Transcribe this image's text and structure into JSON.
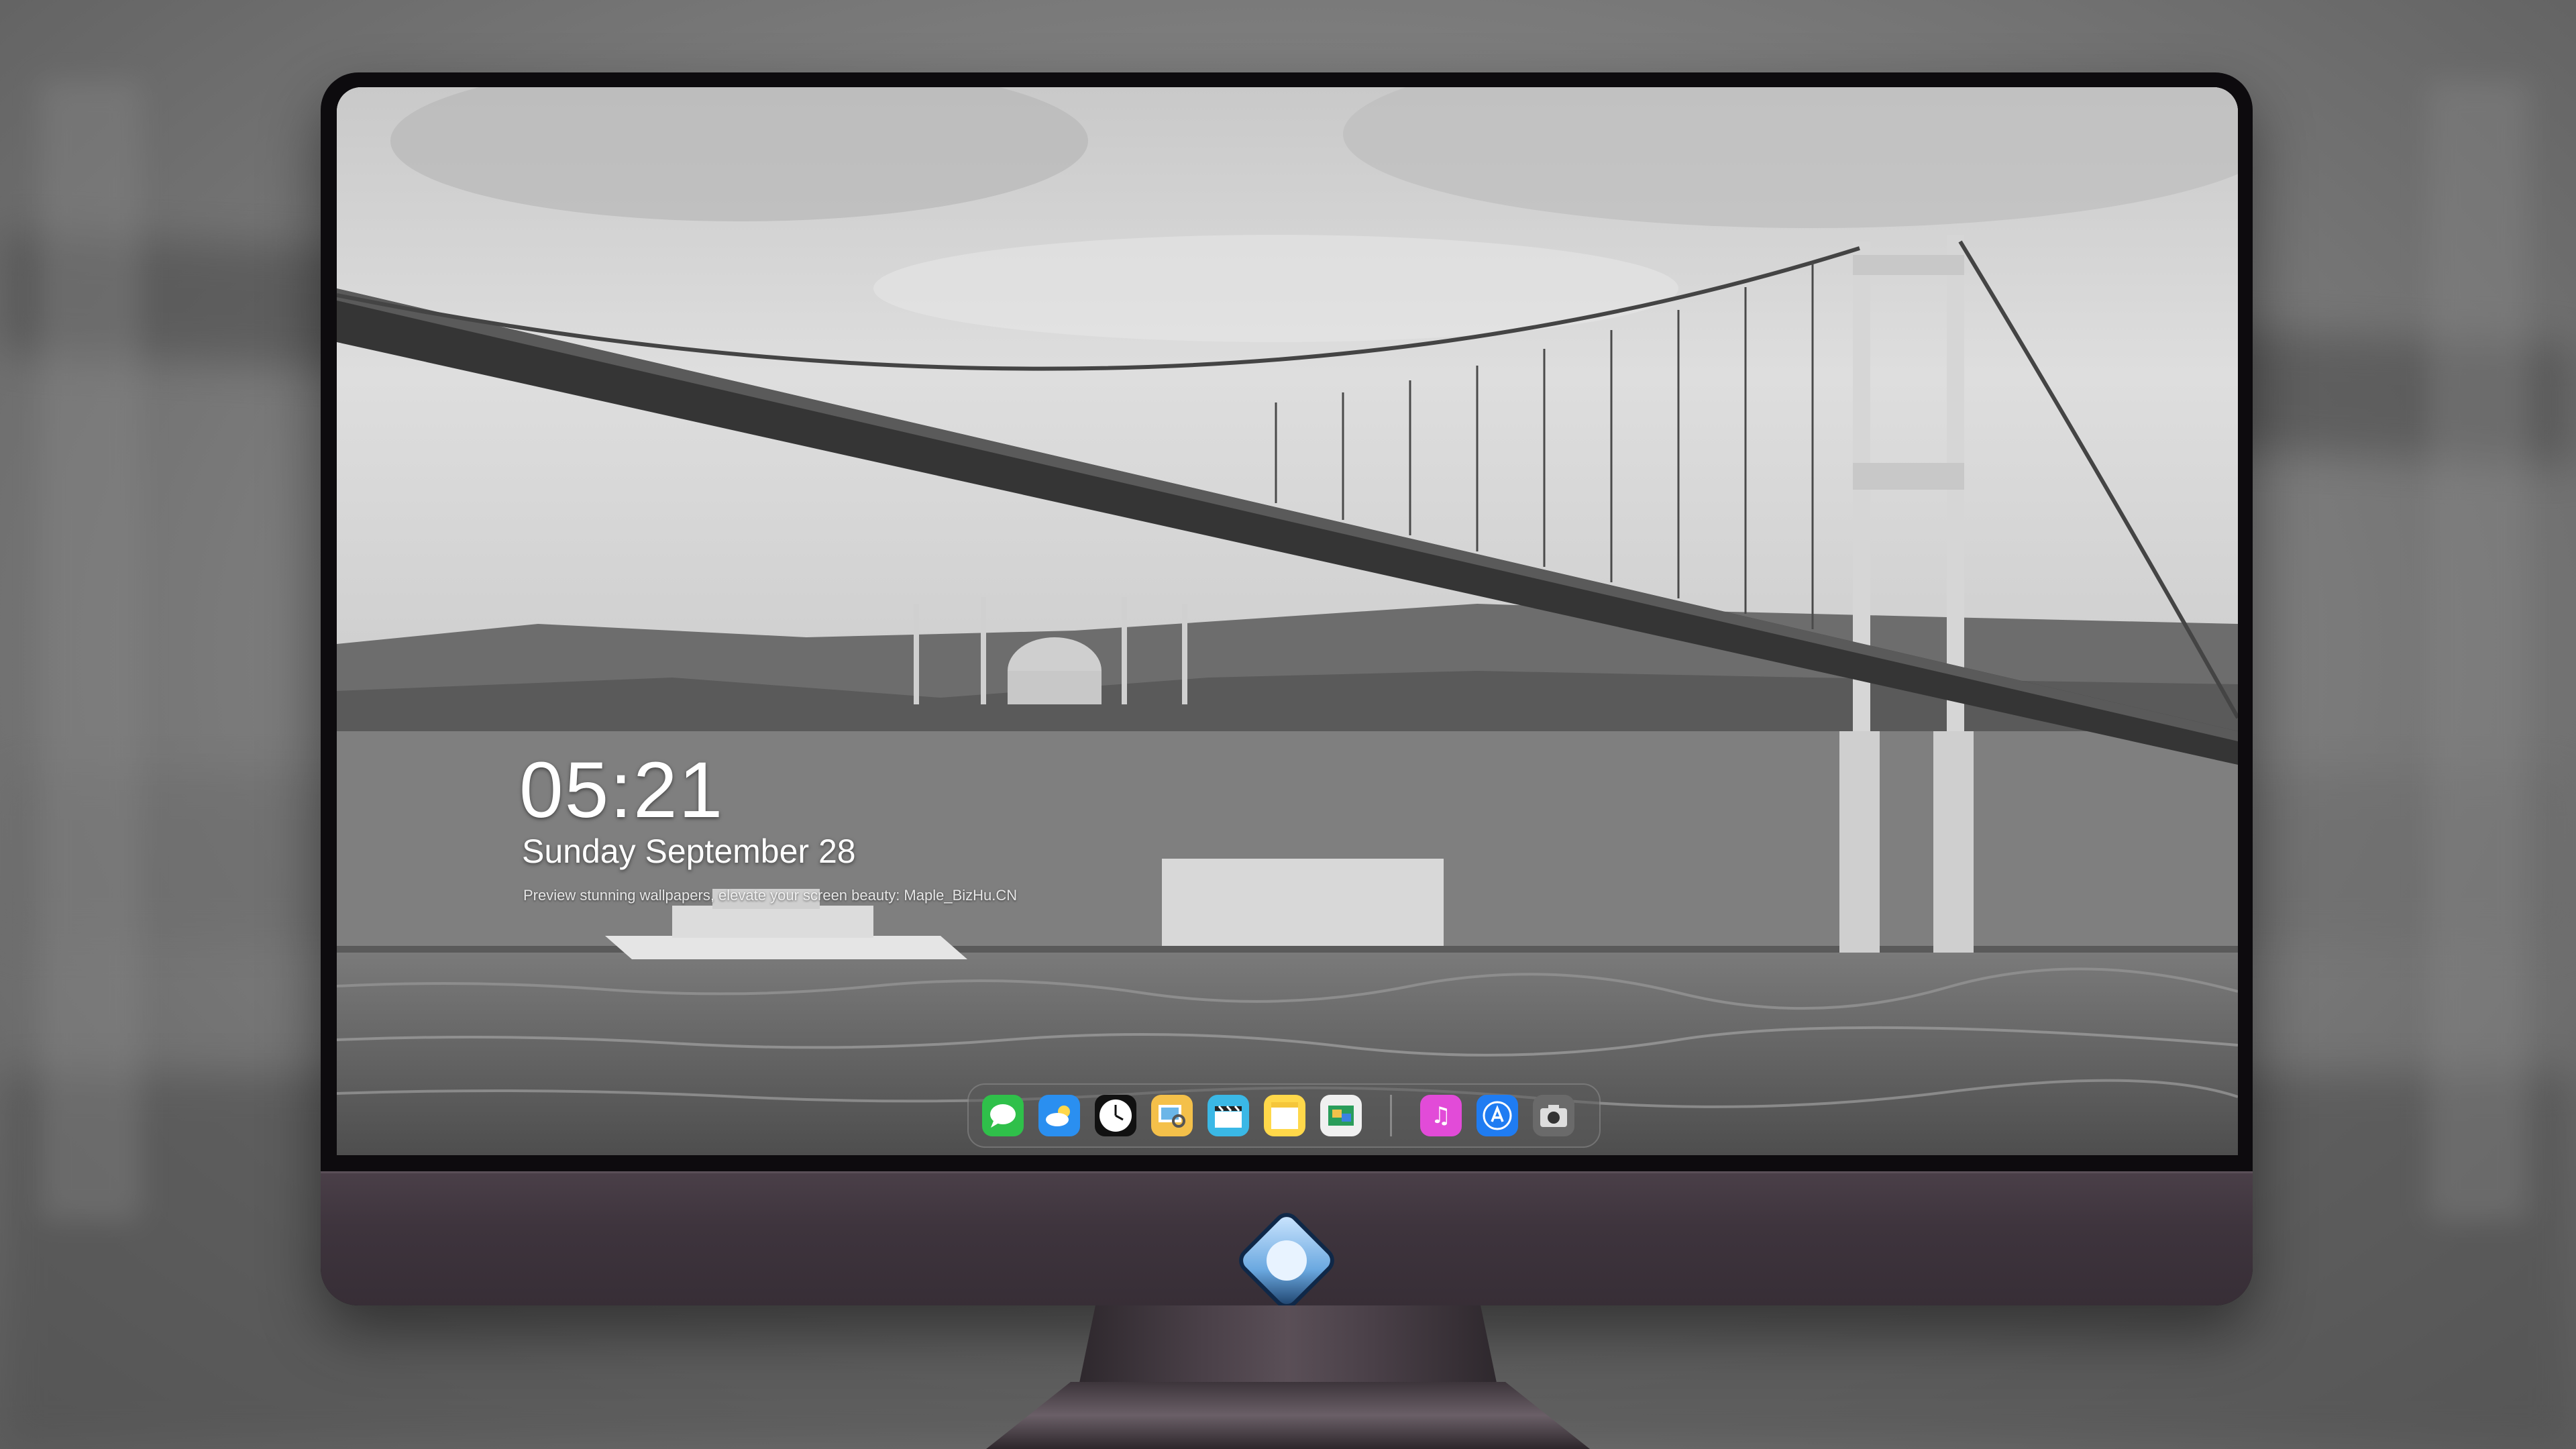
{
  "lock_screen": {
    "time": "05:21",
    "date": "Sunday September 28",
    "tagline": "Preview stunning wallpapers, elevate your screen beauty: Maple_BizHu.CN"
  },
  "dock": {
    "apps": [
      {
        "name": "Messages",
        "icon": "message-bubble",
        "color": "#2fc04a"
      },
      {
        "name": "Weather",
        "icon": "cloud-sun",
        "color": "#2a8ff0"
      },
      {
        "name": "Clock",
        "icon": "analog-clock",
        "color": "#111111"
      },
      {
        "name": "Preview",
        "icon": "photo-loupe",
        "color": "#f4c04a"
      },
      {
        "name": "Video",
        "icon": "clapperboard",
        "color": "#3ab8e6"
      },
      {
        "name": "Notes",
        "icon": "notepad",
        "color": "#ffd84a"
      },
      {
        "name": "Photo Slideshow",
        "icon": "slideshow",
        "color": "#f0f0f0"
      },
      {
        "name": "Music",
        "icon": "music-note",
        "color": "#e24bd8"
      },
      {
        "name": "App Store",
        "icon": "app-store-a",
        "color": "#1f7cf2"
      },
      {
        "name": "Camera",
        "icon": "camera",
        "color": "#6a6a6a"
      }
    ]
  },
  "brand": {
    "logo": "mascot-badge",
    "chin_color": "#3e343d"
  }
}
